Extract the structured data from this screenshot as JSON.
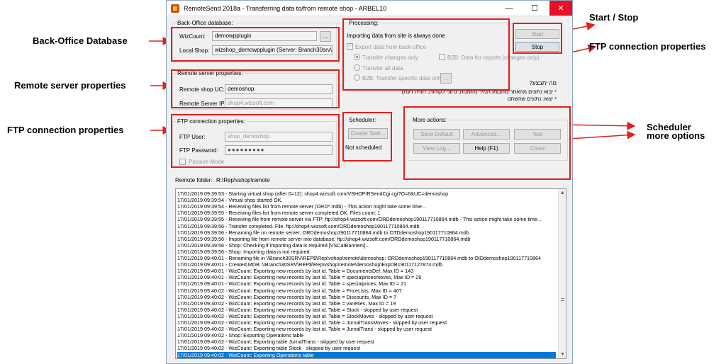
{
  "window": {
    "title": "RemoteSend 2018a - Transferring data to/from remote shop - ARBEL10",
    "minimize": "—",
    "maximize": "☐",
    "close": "✕"
  },
  "backoffice": {
    "title": "Back-Office database:",
    "wizcount_label": "WizCount:",
    "wizcount_value": "demowpplugin",
    "browse_label": "...",
    "localshop_label": "Local Shop:",
    "localshop_value": "wizshop_demowpplugin (Server: Branch30srv\\wizs"
  },
  "remote": {
    "title": "Remote server properties:",
    "uc_label": "Remote shop UC:",
    "uc_value": "demoshop",
    "ip_label": "Remote Server IP:",
    "ip_value": "shop4.wizsoft.com"
  },
  "ftp": {
    "title": "FTP connection properties:",
    "user_label": "FTP User:",
    "user_value": "shop_demoshop",
    "password_label": "FTP Password:",
    "password_value": "●●●●●●●●●",
    "passive_label": "Passive Mode"
  },
  "remote_folder": {
    "label": "Remote folder:",
    "value": "R:\\Rep\\vshop\\remote"
  },
  "processing": {
    "title": "Processing:",
    "info": "Importing data from site is always done",
    "export_label": "Export data from back-office",
    "transfer_changes": "Transfer changes only",
    "transfer_all": "Transfer all data",
    "b2b_specific": "B2B: Transfer specific data only",
    "b2b_specific_btn": "...",
    "b2b_reports": "B2B: Data for reports (changes only)"
  },
  "hebrew": {
    "line1": "מה יתבצע?",
    "line2": "* יבוא נתונים מהאתר מתבצע תמיד (הזמנות, נתוני לקוחות, תווית דעת)",
    "line3": "* יצוא: נתונים שהשתנו"
  },
  "controls": {
    "start": "Start",
    "stop": "Stop"
  },
  "scheduler": {
    "title": "Scheduler:",
    "create_task": "Create Task...",
    "status": "Not scheduled"
  },
  "more_actions": {
    "title": "More actions:",
    "save_default": "Save Default",
    "advanced": "Advanced...",
    "test": "Test",
    "view_log": "View Log...",
    "help": "Help (F1)",
    "close": "Close"
  },
  "log": [
    "17/01/2019 09:39:53 - Starting virtual shop (after 0=12): shop4.wizsoft.com/VSHOP/RSendCgi.cgi?O=6&UC=demoshop",
    "17/01/2019 09:39:54 - Virtual shop started OK.",
    "17/01/2019 09:39:54 - Receiving files list from remote server (ORD*.mdb) - This action might take some time...",
    "17/01/2019 09:39:55 - Receiving files list from remote server completed OK. Files count: 1",
    "17/01/2019 09:39:55 - Receiving file from remote server via FTP: ftp://shop4.wizsoft.com/ORDdemoshop190117710864.mdb - This action might take some time...",
    "17/01/2019 09:39:56 - Transfer completed. File: ftp://shop4.wizsoft.com/ORDdemoshop190117710864.mdb",
    "17/01/2019 09:39:56 - Renaming file on remote server: ORDdemoshop190117710864.mdb to OTDdemoshop190117710864.mdb",
    "17/01/2019 09:39:56 - Importing file from remote server into database: ftp://shop4.wizsoft.com/ORDdemoshop190117710864.mdb",
    "17/01/2019 09:39:56 - Shop: Checking if importing data is required [VSCatBanners]...",
    "17/01/2019 09:39:56 - Shop: Importing data is not required",
    "17/01/2019 09:40:01 - Renaming file in \\\\Branch30SRV\\REP$\\Rep\\vshop\\remote\\demoshop: ORDdemoshop190117710864.mdb to OIDdemoshop190117710864",
    "17/01/2019 09:40:01 - Created MDB: \\\\Branch30SRV\\REP$\\Rep\\vshop\\remote\\demoshop\\ExpDB190117127873.mdb",
    "17/01/2019 09:40:01 - WizCount: Exporting new records by last id. Table = DocumentsDef, Max ID = 143",
    "17/01/2019 09:40:01 - WizCount: Exporting new records by last id. Table = specialpricesmoves, Max ID = 29",
    "17/01/2019 09:40:01 - WizCount: Exporting new records by last id. Table = specialprices, Max ID = 21",
    "17/01/2019 09:40:02 - WizCount: Exporting new records by last id. Table = PriceLists, Max ID = 407",
    "17/01/2019 09:40:02 - WizCount: Exporting new records by last id. Table = Discounts, Max ID = 7",
    "17/01/2019 09:40:02 - WizCount: Exporting new records by last id. Table = varieties, Max ID = 19",
    "17/01/2019 09:40:02 - WizCount: Exporting new records by last id. Table = Stock - skipped by user request",
    "17/01/2019 09:40:02 - WizCount: Exporting new records by last id. Table = StockMoves - skipped by user request",
    "17/01/2019 09:40:02 - WizCount: Exporting new records by last id. Table = JurnalTransMoves - skipped by user request",
    "17/01/2019 09:40:02 - WizCount: Exporting new records by last id. Table = JurnalTrans - skipped by user request",
    "17/01/2019 09:40:02 - Shop: Exporting Operations table",
    "17/01/2019 09:40:02 - WizCount: Exporting table JurnalTrans - skipped by user request",
    "17/01/2019 09:40:02 - WizCount: Exporting table Stock - skipped by user request",
    "17/01/2019 09:40:02 - WizCount: Exporting Operations table"
  ],
  "annotations": {
    "backoffice": "Back-Office Database",
    "remote": "Remote server properties",
    "ftp_left": "FTP connection properties",
    "start_stop": "Start / Stop",
    "ftp_right": "FTP connection properties",
    "scheduler": "Scheduler",
    "more": "more options"
  },
  "colors": {
    "annotation_red": "#e0201a",
    "selection_blue": "#0078d7",
    "close_red": "#e81123"
  }
}
